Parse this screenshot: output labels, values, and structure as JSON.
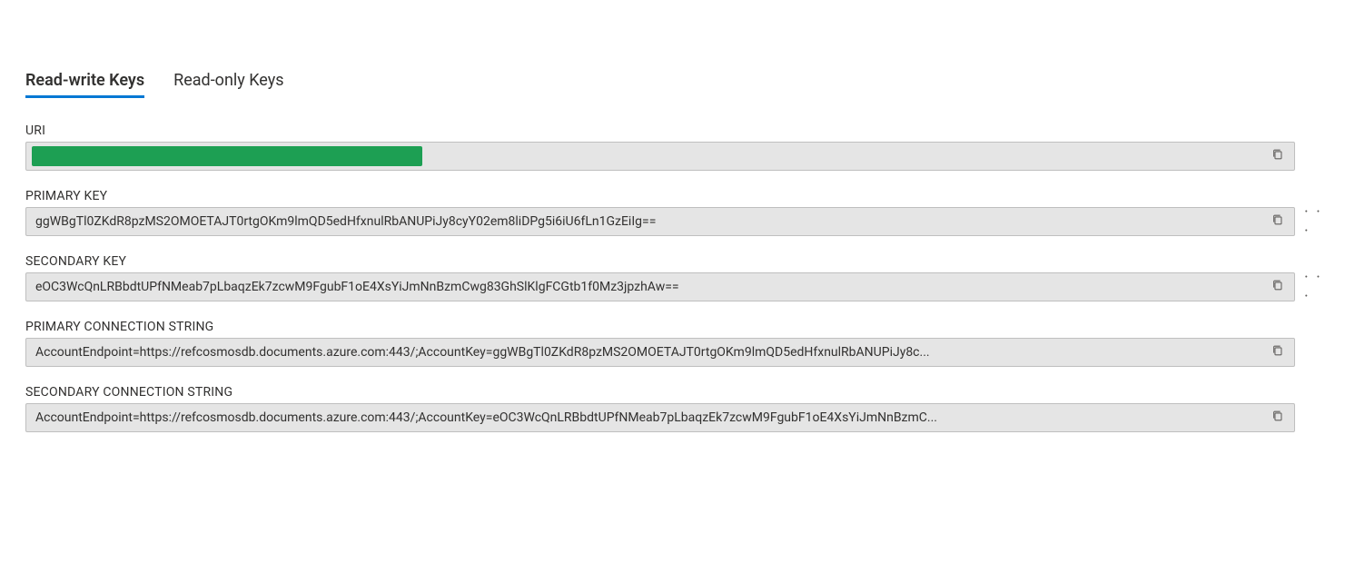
{
  "tabs": {
    "readwrite": "Read-write Keys",
    "readonly": "Read-only Keys"
  },
  "fields": {
    "uri": {
      "label": "URI",
      "value": ""
    },
    "primary_key": {
      "label": "PRIMARY KEY",
      "value": "ggWBgTl0ZKdR8pzMS2OMOETAJT0rtgOKm9lmQD5edHfxnulRbANUPiJy8cyY02em8liDPg5i6iU6fLn1GzEiIg=="
    },
    "secondary_key": {
      "label": "SECONDARY KEY",
      "value": "eOC3WcQnLRBbdtUPfNMeab7pLbaqzEk7zcwM9FgubF1oE4XsYiJmNnBzmCwg83GhSlKlgFCGtb1f0Mz3jpzhAw=="
    },
    "primary_conn": {
      "label": "PRIMARY CONNECTION STRING",
      "value": "AccountEndpoint=https://refcosmosdb.documents.azure.com:443/;AccountKey=ggWBgTl0ZKdR8pzMS2OMOETAJT0rtgOKm9lmQD5edHfxnulRbANUPiJy8c..."
    },
    "secondary_conn": {
      "label": "SECONDARY CONNECTION STRING",
      "value": "AccountEndpoint=https://refcosmosdb.documents.azure.com:443/;AccountKey=eOC3WcQnLRBbdtUPfNMeab7pLbaqzEk7zcwM9FgubF1oE4XsYiJmNnBzmC..."
    }
  },
  "icons": {
    "more": "· · ·"
  }
}
